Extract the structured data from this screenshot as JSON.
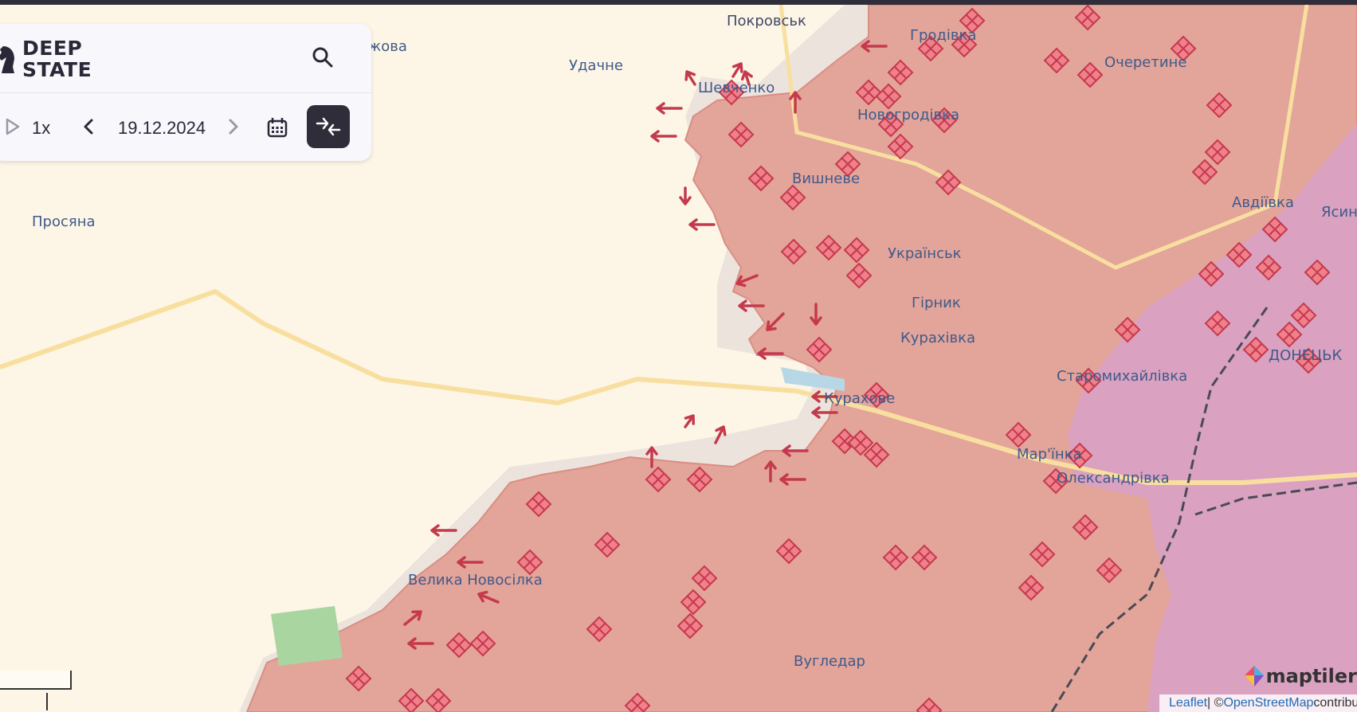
{
  "app": {
    "logo_line1": "DEEP",
    "logo_line2": "STATE"
  },
  "toolbar": {
    "speed": "1x",
    "date": "19.12.2024"
  },
  "map_labels": {
    "pokrovsk": "Покровськ",
    "udachne": "Удачне",
    "zhovta": "жова",
    "prosiana": "Просяна",
    "hrodivka": "Гродівка",
    "ocheretyne": "Очеретине",
    "shevchenko": "Шевченко",
    "novohrodivka": "Новогродівка",
    "vyshneve": "Вишневе",
    "avdiivka": "Авдіївка",
    "yasynuvata": "Ясин",
    "ukrainsk": "Українськ",
    "hirnyk": "Гірник",
    "kurakhivka": "Курахівка",
    "donetsk": "ДОНЕЦЬК",
    "kurakhove": "Курахове",
    "staromykhailivka": "Старомихайлівка",
    "marinka": "Мар'їнка",
    "oleksandrivka": "Олександрівка",
    "velyka_novosilka": "Велика Новосілка",
    "vuhledar": "Вугледар"
  },
  "attribution": {
    "leaflet": "Leaflet",
    "separator": " | © ",
    "osm": "OpenStreetMap",
    "contrib": " contributors"
  },
  "watermark": "maptiler",
  "colors": {
    "occupied": "#e3a49a",
    "occupied_border": "#d98e84",
    "pre_2022": "#dca3c6",
    "liberated_zone": "#ede3dd",
    "road": "#f8dfa0",
    "marker": "#e5576a",
    "arrow": "#e5576a"
  }
}
